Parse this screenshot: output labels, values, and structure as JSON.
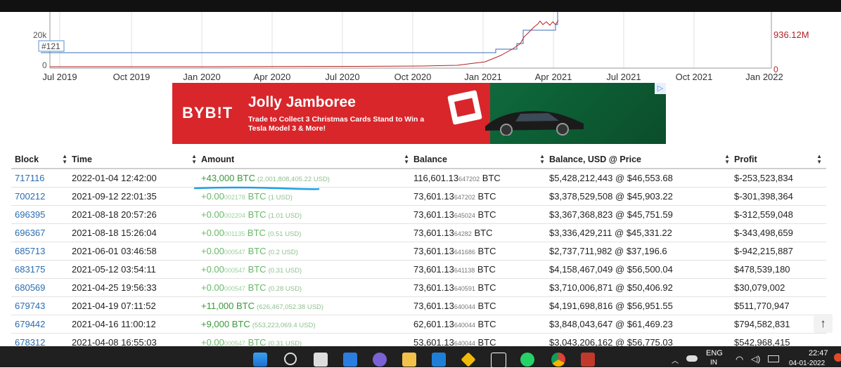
{
  "chart": {
    "y_left_top": "20k",
    "y_left_bottom": "0",
    "y_right_top": "936.12M",
    "y_right_bottom": "0",
    "marker": "#121",
    "x_ticks": [
      "Jul 2019",
      "Oct 2019",
      "Jan 2020",
      "Apr 2020",
      "Jul 2020",
      "Oct 2020",
      "Jan 2021",
      "Apr 2021",
      "Jul 2021",
      "Oct 2021",
      "Jan 2022"
    ]
  },
  "ad": {
    "brand": "BYB!T",
    "title": "Jolly Jamboree",
    "subtitle": "Trade to Collect 3 Christmas Cards Stand to Win a Tesla Model 3 & More!",
    "info_icon": "info-triangle-icon"
  },
  "table": {
    "headers": {
      "block": "Block",
      "time": "Time",
      "amount": "Amount",
      "balance": "Balance",
      "usd": "Balance, USD @ Price",
      "profit": "Profit"
    },
    "rows": [
      {
        "block": "717116",
        "time": "2022-01-04 12:42:00",
        "amount_main": "+43,000",
        "amount_small": "",
        "amount_unit": " BTC",
        "amount_usd": "(2,001,808,405.22 USD)",
        "bal_main": "116,601.13",
        "bal_small": "647202",
        "bal_unit": " BTC",
        "usd": "$5,428,212,443 @ $46,553.68",
        "profit": "$-253,523,834"
      },
      {
        "block": "700212",
        "time": "2021-09-12 22:01:35",
        "amount_main": "+0.00",
        "amount_small": "002178",
        "amount_unit": " BTC",
        "amount_usd": "(1 USD)",
        "bal_main": "73,601.13",
        "bal_small": "647202",
        "bal_unit": " BTC",
        "usd": "$3,378,529,508 @ $45,903.22",
        "profit": "$-301,398,364"
      },
      {
        "block": "696395",
        "time": "2021-08-18 20:57:26",
        "amount_main": "+0.00",
        "amount_small": "002204",
        "amount_unit": " BTC",
        "amount_usd": "(1.01 USD)",
        "bal_main": "73,601.13",
        "bal_small": "645024",
        "bal_unit": " BTC",
        "usd": "$3,367,368,823 @ $45,751.59",
        "profit": "$-312,559,048"
      },
      {
        "block": "696367",
        "time": "2021-08-18 15:26:04",
        "amount_main": "+0.00",
        "amount_small": "001135",
        "amount_unit": " BTC",
        "amount_usd": "(0.51 USD)",
        "bal_main": "73,601.13",
        "bal_small": "64282",
        "bal_unit": " BTC",
        "usd": "$3,336,429,211 @ $45,331.22",
        "profit": "$-343,498,659"
      },
      {
        "block": "685713",
        "time": "2021-06-01 03:46:58",
        "amount_main": "+0.00",
        "amount_small": "000547",
        "amount_unit": " BTC",
        "amount_usd": "(0.2 USD)",
        "bal_main": "73,601.13",
        "bal_small": "641686",
        "bal_unit": " BTC",
        "usd": "$2,737,711,982 @ $37,196.6",
        "profit": "$-942,215,887"
      },
      {
        "block": "683175",
        "time": "2021-05-12 03:54:11",
        "amount_main": "+0.00",
        "amount_small": "000547",
        "amount_unit": " BTC",
        "amount_usd": "(0.31 USD)",
        "bal_main": "73,601.13",
        "bal_small": "641138",
        "bal_unit": " BTC",
        "usd": "$4,158,467,049 @ $56,500.04",
        "profit": "$478,539,180"
      },
      {
        "block": "680569",
        "time": "2021-04-25 19:56:33",
        "amount_main": "+0.00",
        "amount_small": "000547",
        "amount_unit": " BTC",
        "amount_usd": "(0.28 USD)",
        "bal_main": "73,601.13",
        "bal_small": "640591",
        "bal_unit": " BTC",
        "usd": "$3,710,006,871 @ $50,406.92",
        "profit": "$30,079,002"
      },
      {
        "block": "679743",
        "time": "2021-04-19 07:11:52",
        "amount_main": "+11,000",
        "amount_small": "",
        "amount_unit": " BTC",
        "amount_usd": "(626,467,052.38 USD)",
        "bal_main": "73,601.13",
        "bal_small": "640044",
        "bal_unit": " BTC",
        "usd": "$4,191,698,816 @ $56,951.55",
        "profit": "$511,770,947"
      },
      {
        "block": "679442",
        "time": "2021-04-16 11:00:12",
        "amount_main": "+9,000",
        "amount_small": "",
        "amount_unit": " BTC",
        "amount_usd": "(553,223,069.4 USD)",
        "bal_main": "62,601.13",
        "bal_small": "640044",
        "bal_unit": " BTC",
        "usd": "$3,848,043,647 @ $61,469.23",
        "profit": "$794,582,831"
      },
      {
        "block": "678312",
        "time": "2021-04-08 16:55:03",
        "amount_main": "+0.00",
        "amount_small": "000547",
        "amount_unit": " BTC",
        "amount_usd": "(0.31 USD)",
        "bal_main": "53,601.13",
        "bal_small": "640044",
        "bal_unit": " BTC",
        "usd": "$3,043,206,162 @ $56,775.03",
        "profit": "$542,968,415"
      }
    ]
  },
  "scroll_top": "↑",
  "taskbar": {
    "lang": "ENG",
    "lang_sub": "IN",
    "time": "22:47",
    "date": "04-01-2022"
  },
  "colors": {
    "accent_link": "#2a6db0",
    "amount_green": "#3a9a3a",
    "underline": "#1ea0e8",
    "ad_red": "#d8262b"
  }
}
